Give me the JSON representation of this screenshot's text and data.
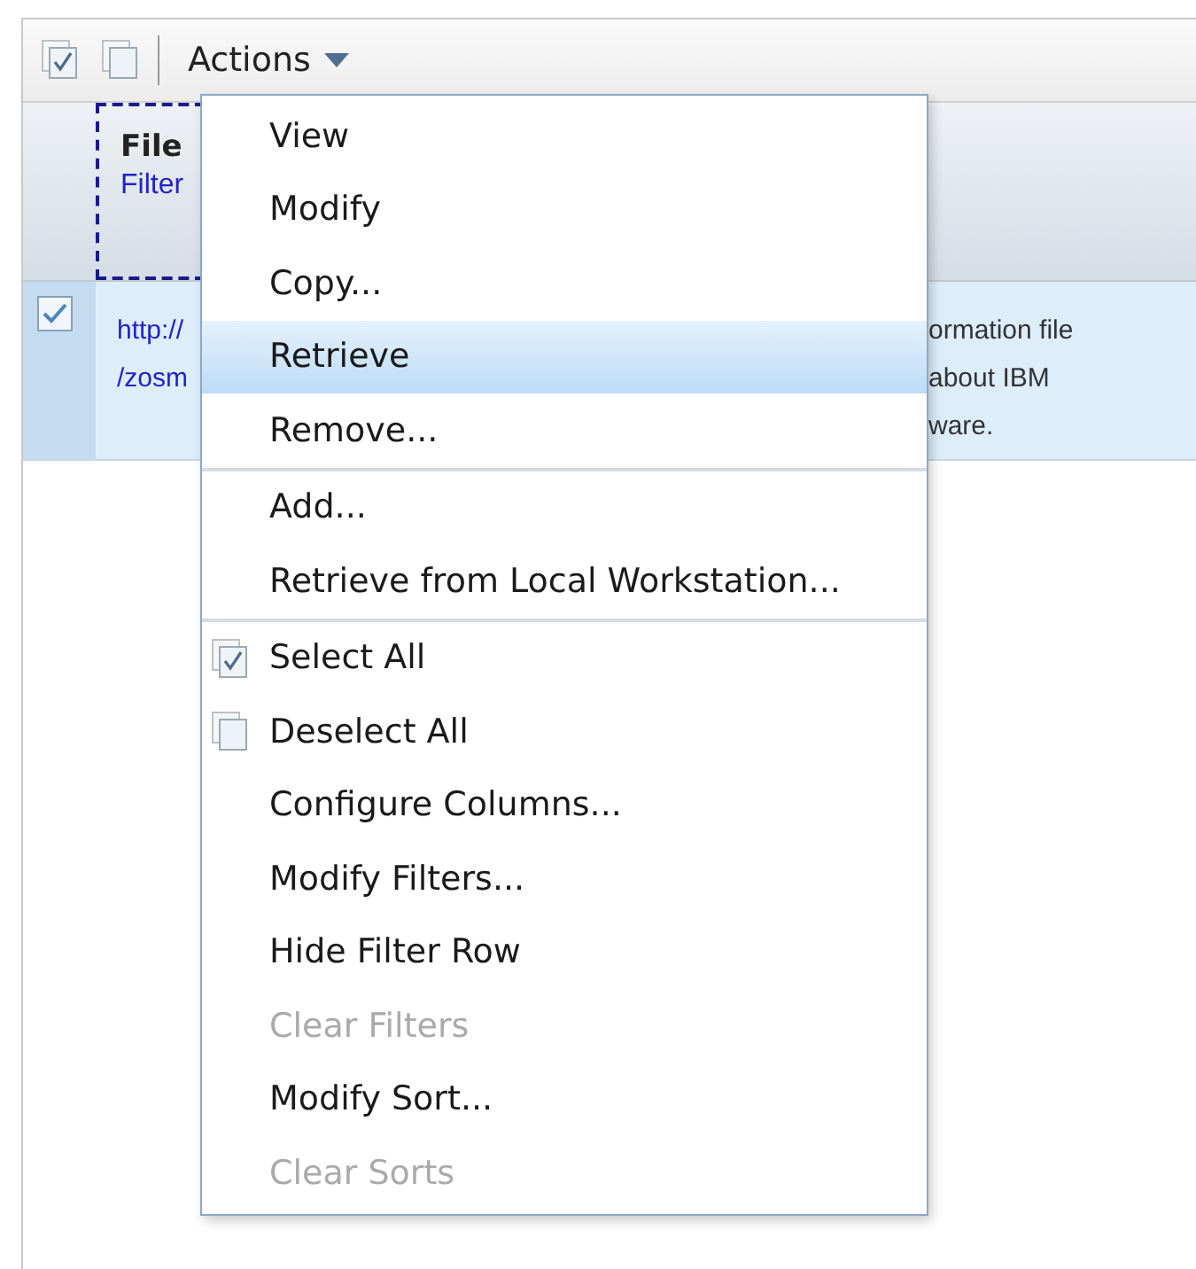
{
  "toolbar": {
    "actions_label": "Actions"
  },
  "table": {
    "columns": [
      {
        "title": "File",
        "filter": "Filter",
        "focused": true
      }
    ],
    "rows": [
      {
        "checked": true,
        "selected": true,
        "column_1": [
          "http://",
          "/zosm"
        ],
        "column_2": [
          "ormation file",
          "about IBM",
          "ware."
        ]
      }
    ]
  },
  "menu": {
    "groups": [
      [
        {
          "label": "View",
          "kind": "plain",
          "selected": false,
          "disabled": false
        },
        {
          "label": "Modify",
          "kind": "plain",
          "selected": false,
          "disabled": false
        },
        {
          "label": "Copy...",
          "kind": "plain",
          "selected": false,
          "disabled": false
        },
        {
          "label": "Retrieve",
          "kind": "plain",
          "selected": true,
          "disabled": false
        },
        {
          "label": "Remove...",
          "kind": "plain",
          "selected": false,
          "disabled": false
        }
      ],
      [
        {
          "label": "Add...",
          "kind": "plain",
          "selected": false,
          "disabled": false
        },
        {
          "label": "Retrieve from Local Workstation...",
          "kind": "plain",
          "selected": false,
          "disabled": false
        }
      ],
      [
        {
          "label": "Select All",
          "kind": "select-all",
          "selected": false,
          "disabled": false
        },
        {
          "label": "Deselect All",
          "kind": "deselect-all",
          "selected": false,
          "disabled": false
        },
        {
          "label": "Configure Columns...",
          "kind": "plain",
          "selected": false,
          "disabled": false
        },
        {
          "label": "Modify Filters...",
          "kind": "plain",
          "selected": false,
          "disabled": false
        },
        {
          "label": "Hide Filter Row",
          "kind": "plain",
          "selected": false,
          "disabled": false
        },
        {
          "label": "Clear Filters",
          "kind": "plain",
          "selected": false,
          "disabled": true
        },
        {
          "label": "Modify Sort...",
          "kind": "plain",
          "selected": false,
          "disabled": false
        },
        {
          "label": "Clear Sorts",
          "kind": "plain",
          "selected": false,
          "disabled": true
        }
      ]
    ]
  }
}
